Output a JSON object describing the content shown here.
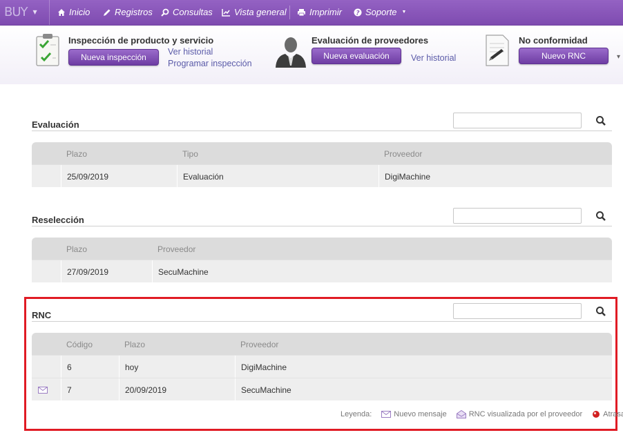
{
  "navbar": {
    "brand": "BUY",
    "items": [
      {
        "label": "Inicio",
        "icon": "home-icon"
      },
      {
        "label": "Registros",
        "icon": "pencil-icon"
      },
      {
        "label": "Consultas",
        "icon": "search-icon"
      },
      {
        "label": "Vista general",
        "icon": "line-chart-icon"
      },
      {
        "label": "Imprimir",
        "icon": "printer-icon"
      },
      {
        "label": "Soporte",
        "icon": "help-circle-icon"
      }
    ]
  },
  "shortcuts": {
    "inspection": {
      "title": "Inspección de producto y servicio",
      "button": "Nueva inspección",
      "link_history": "Ver historial",
      "link_schedule": "Programar inspección"
    },
    "supplier_eval": {
      "title": "Evaluación de proveedores",
      "button": "Nueva evaluación",
      "link_history": "Ver historial"
    },
    "nonconformity": {
      "title": "No conformidad",
      "button": "Nuevo RNC"
    }
  },
  "sections": {
    "evaluacion": {
      "title": "Evaluación",
      "columns": [
        "Plazo",
        "Tipo",
        "Proveedor"
      ],
      "rows": [
        {
          "plazo": "25/09/2019",
          "tipo": "Evaluación",
          "proveedor": "DigiMachine"
        }
      ]
    },
    "reseleccion": {
      "title": "Reselección",
      "columns": [
        "Plazo",
        "Proveedor"
      ],
      "rows": [
        {
          "plazo": "27/09/2019",
          "proveedor": "SecuMachine"
        }
      ]
    },
    "rnc": {
      "title": "RNC",
      "columns": [
        "Código",
        "Plazo",
        "Proveedor"
      ],
      "rows": [
        {
          "codigo": "6",
          "plazo": "hoy",
          "proveedor": "DigiMachine",
          "icon": ""
        },
        {
          "codigo": "7",
          "plazo": "20/09/2019",
          "proveedor": "SecuMachine",
          "icon": "envelope-icon"
        }
      ]
    }
  },
  "legend": {
    "label": "Leyenda:",
    "new_message": "Nuevo mensaje",
    "viewed": "RNC visualizada por el proveedor",
    "late": "Atrasado"
  },
  "colors": {
    "navbar": "#8755ba",
    "button": "#7e4bb0",
    "highlight": "#e01b24",
    "late_dot": "#d21f1f"
  }
}
